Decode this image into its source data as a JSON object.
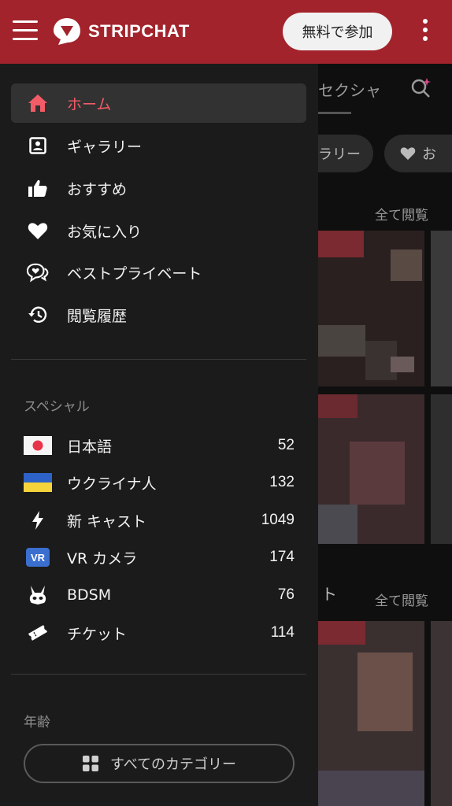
{
  "header": {
    "logo_text": "STRIPCHAT",
    "join_label": "無料で参加",
    "bg_color": "#a2232b"
  },
  "background": {
    "tab_label": "セクシャ",
    "chip1": "ラリー",
    "chip2": "お",
    "view_all_1": "全て閲覧",
    "view_all_2": "全て閲覧",
    "section_title": "ト"
  },
  "drawer": {
    "nav_items": [
      {
        "label": "ホーム",
        "icon": "home-icon",
        "active": true
      },
      {
        "label": "ギャラリー",
        "icon": "gallery-icon",
        "active": false
      },
      {
        "label": "おすすめ",
        "icon": "thumbs-up-icon",
        "active": false
      },
      {
        "label": "お気に入り",
        "icon": "heart-icon",
        "active": false
      },
      {
        "label": "ベストプライベート",
        "icon": "chat-heart-icon",
        "active": false
      },
      {
        "label": "閲覧履歴",
        "icon": "history-icon",
        "active": false
      }
    ],
    "special_label": "スペシャル",
    "categories": [
      {
        "label": "日本語",
        "count": "52",
        "icon": "japan-flag-icon"
      },
      {
        "label": "ウクライナ人",
        "count": "132",
        "icon": "ukraine-flag-icon"
      },
      {
        "label": "新 キャスト",
        "count": "1049",
        "icon": "lightning-icon"
      },
      {
        "label": "VR カメラ",
        "count": "174",
        "icon": "vr-badge-icon",
        "badge_text": "VR"
      },
      {
        "label": "BDSM",
        "count": "76",
        "icon": "bunny-mask-icon"
      },
      {
        "label": "チケット",
        "count": "114",
        "icon": "ticket-icon"
      }
    ],
    "age_label": "年齢",
    "all_categories_label": "すべてのカテゴリー",
    "accent_color": "#f25c67"
  }
}
